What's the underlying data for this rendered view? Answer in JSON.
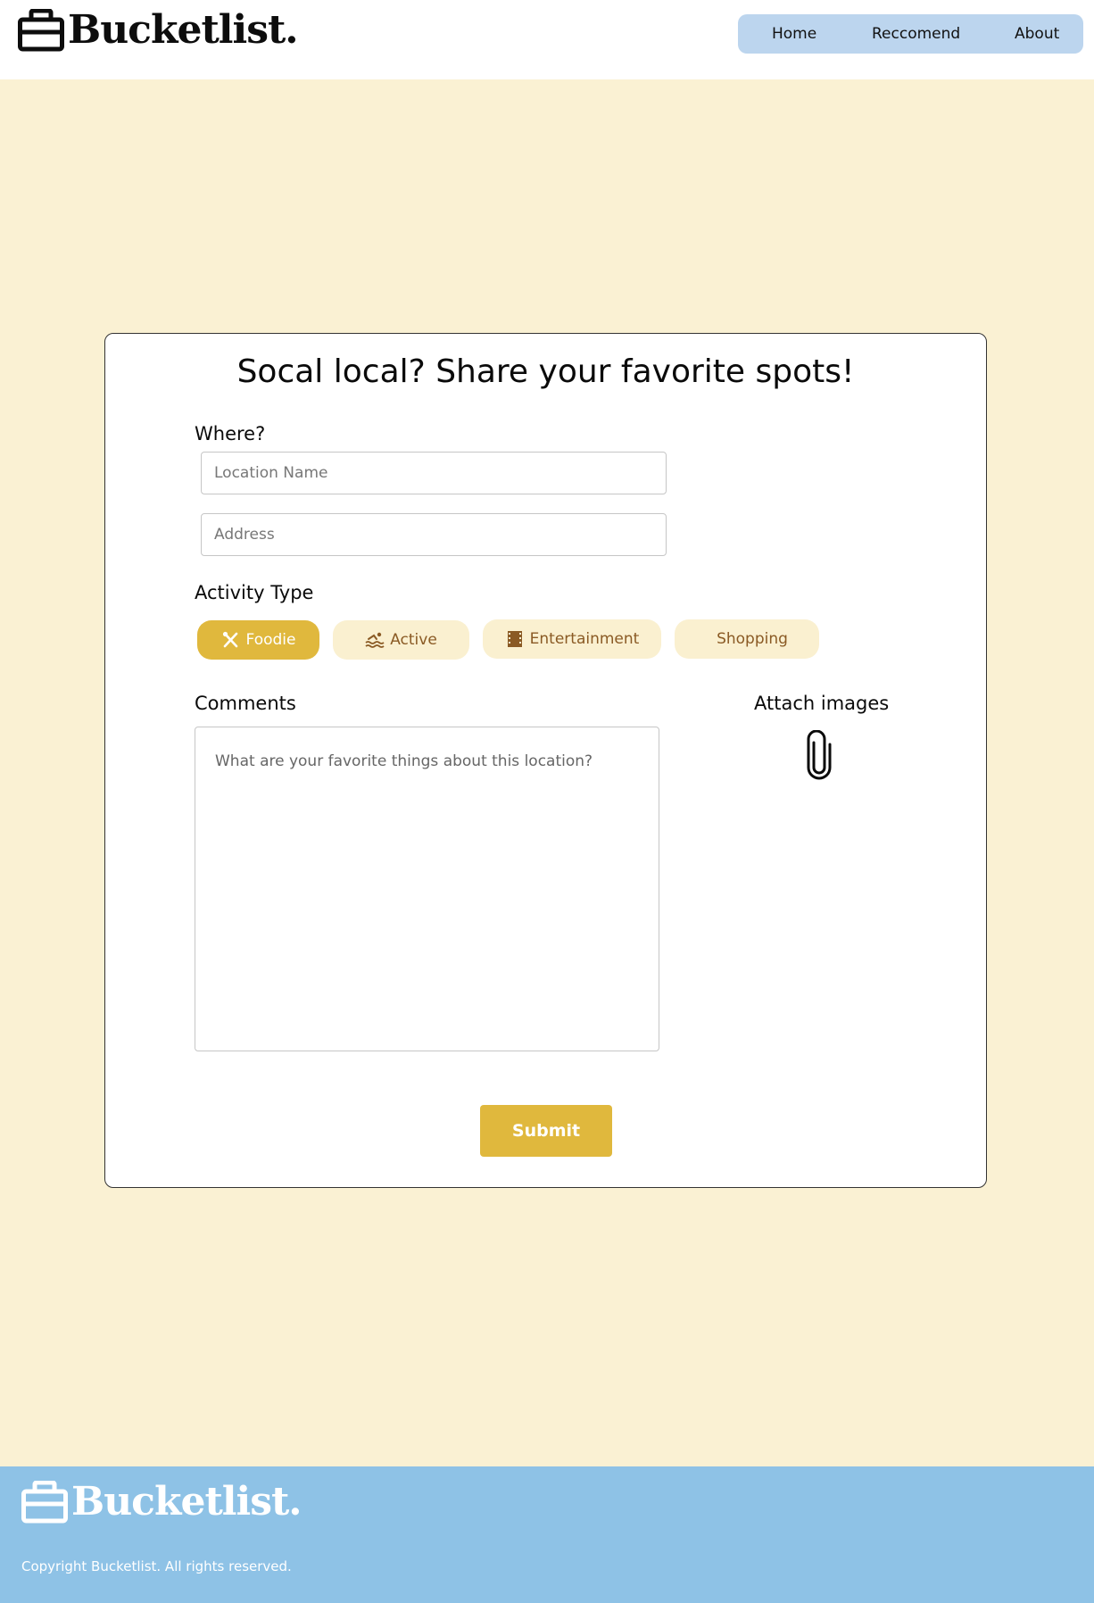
{
  "header": {
    "logo_text": "Bucketlist.",
    "nav": [
      {
        "label": "Home"
      },
      {
        "label": "Reccomend"
      },
      {
        "label": "About"
      }
    ]
  },
  "form": {
    "title": "Socal local? Share your favorite spots!",
    "where_label": "Where?",
    "location_placeholder": "Location Name",
    "address_placeholder": "Address",
    "activity_label": "Activity Type",
    "activities": [
      {
        "label": "Foodie",
        "icon": "utensils-icon",
        "selected": true
      },
      {
        "label": "Active",
        "icon": "swimming-icon",
        "selected": false
      },
      {
        "label": "Entertainment",
        "icon": "film-icon",
        "selected": false
      },
      {
        "label": "Shopping",
        "icon": "",
        "selected": false
      }
    ],
    "comments_label": "Comments",
    "comments_placeholder": "What are your favorite things about this location?",
    "attach_label": "Attach images",
    "attach_icon": "paperclip-icon",
    "submit_label": "Submit"
  },
  "footer": {
    "logo_text": "Bucketlist.",
    "copyright": "Copyright Bucketlist. All rights reserved."
  },
  "colors": {
    "page_bg": "#faf1d3",
    "nav_bg": "#bcd5ee",
    "accent": "#e0b83d",
    "chip_bg": "#faf0d0",
    "chip_text": "#8a5a24",
    "footer_bg": "#8ec2e6"
  }
}
